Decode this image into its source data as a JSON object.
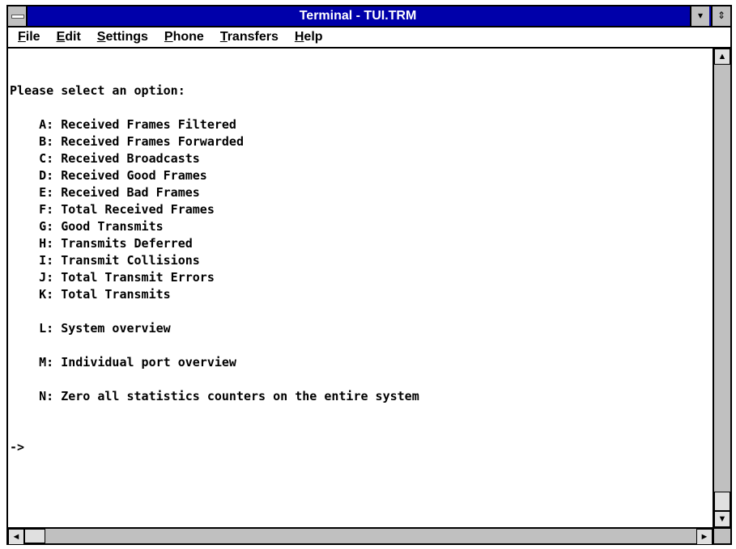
{
  "window": {
    "title": "Terminal - TUI.TRM"
  },
  "titlebar_buttons": {
    "minimize_glyph": "▾",
    "maximize_glyph": "⇕"
  },
  "menubar": {
    "items": [
      {
        "underline": "F",
        "rest": "ile"
      },
      {
        "underline": "E",
        "rest": "dit"
      },
      {
        "underline": "S",
        "rest": "ettings"
      },
      {
        "underline": "P",
        "rest": "hone"
      },
      {
        "underline": "T",
        "rest": "ransfers"
      },
      {
        "underline": "H",
        "rest": "elp"
      }
    ]
  },
  "terminal": {
    "lines": [
      "Please select an option:",
      "",
      "    A: Received Frames Filtered",
      "    B: Received Frames Forwarded",
      "    C: Received Broadcasts",
      "    D: Received Good Frames",
      "    E: Received Bad Frames",
      "    F: Total Received Frames",
      "    G: Good Transmits",
      "    H: Transmits Deferred",
      "    I: Transmit Collisions",
      "    J: Total Transmit Errors",
      "    K: Total Transmits",
      "",
      "    L: System overview",
      "",
      "    M: Individual port overview",
      "",
      "    N: Zero all statistics counters on the entire system",
      "",
      "",
      "->"
    ]
  },
  "scrollbars": {
    "up_glyph": "▲",
    "down_glyph": "▼",
    "left_glyph": "◄",
    "right_glyph": "►"
  },
  "colors": {
    "titlebar": "#0000aa",
    "chrome": "#c0c0c0"
  }
}
